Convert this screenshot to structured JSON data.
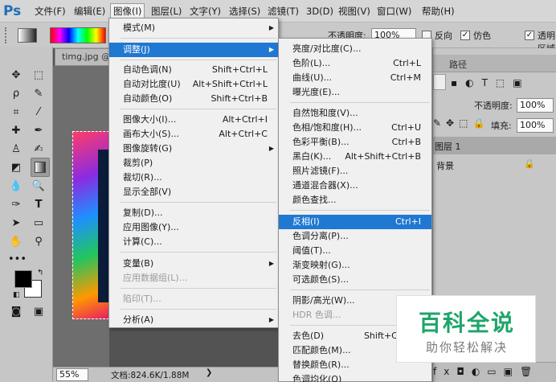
{
  "app": {
    "logo": "Ps"
  },
  "menubar": {
    "items": [
      "文件(F)",
      "编辑(E)",
      "图像(I)",
      "图层(L)",
      "文字(Y)",
      "选择(S)",
      "滤镜(T)",
      "3D(D)",
      "视图(V)",
      "窗口(W)",
      "帮助(H)"
    ]
  },
  "options": {
    "opacity_label": "不透明度:",
    "opacity_value": "100%",
    "reverse_label": "反向",
    "dither_label": "仿色",
    "transparency_label": "透明区域"
  },
  "document": {
    "tab_title": "timg.jpg @",
    "zoom": "55%",
    "doc_info": "文档:824.6K/1.88M"
  },
  "image_menu": {
    "items": [
      {
        "label": "模式(M)",
        "shortcut": "",
        "submenu": true
      },
      {
        "label": "调整(J)",
        "shortcut": "",
        "submenu": true,
        "highlight": true
      },
      {
        "label": "自动色调(N)",
        "shortcut": "Shift+Ctrl+L"
      },
      {
        "label": "自动对比度(U)",
        "shortcut": "Alt+Shift+Ctrl+L"
      },
      {
        "label": "自动颜色(O)",
        "shortcut": "Shift+Ctrl+B"
      },
      {
        "label": "图像大小(I)...",
        "shortcut": "Alt+Ctrl+I"
      },
      {
        "label": "画布大小(S)...",
        "shortcut": "Alt+Ctrl+C"
      },
      {
        "label": "图像旋转(G)",
        "shortcut": "",
        "submenu": true
      },
      {
        "label": "裁剪(P)",
        "shortcut": ""
      },
      {
        "label": "裁切(R)...",
        "shortcut": ""
      },
      {
        "label": "显示全部(V)",
        "shortcut": ""
      },
      {
        "label": "复制(D)...",
        "shortcut": ""
      },
      {
        "label": "应用图像(Y)...",
        "shortcut": ""
      },
      {
        "label": "计算(C)...",
        "shortcut": ""
      },
      {
        "label": "变量(B)",
        "shortcut": "",
        "submenu": true
      },
      {
        "label": "应用数据组(L)...",
        "shortcut": "",
        "disabled": true
      },
      {
        "label": "陷印(T)...",
        "shortcut": "",
        "disabled": true
      },
      {
        "label": "分析(A)",
        "shortcut": "",
        "submenu": true
      }
    ]
  },
  "adjust_menu": {
    "items": [
      {
        "label": "亮度/对比度(C)...",
        "shortcut": ""
      },
      {
        "label": "色阶(L)...",
        "shortcut": "Ctrl+L"
      },
      {
        "label": "曲线(U)...",
        "shortcut": "Ctrl+M"
      },
      {
        "label": "曝光度(E)...",
        "shortcut": ""
      },
      {
        "label": "自然饱和度(V)...",
        "shortcut": ""
      },
      {
        "label": "色相/饱和度(H)...",
        "shortcut": "Ctrl+U"
      },
      {
        "label": "色彩平衡(B)...",
        "shortcut": "Ctrl+B"
      },
      {
        "label": "黑白(K)...",
        "shortcut": "Alt+Shift+Ctrl+B"
      },
      {
        "label": "照片滤镜(F)...",
        "shortcut": ""
      },
      {
        "label": "通道混合器(X)...",
        "shortcut": ""
      },
      {
        "label": "颜色查找...",
        "shortcut": ""
      },
      {
        "label": "反相(I)",
        "shortcut": "Ctrl+I",
        "highlight": true
      },
      {
        "label": "色调分离(P)...",
        "shortcut": ""
      },
      {
        "label": "阈值(T)...",
        "shortcut": ""
      },
      {
        "label": "渐变映射(G)...",
        "shortcut": ""
      },
      {
        "label": "可选颜色(S)...",
        "shortcut": ""
      },
      {
        "label": "阴影/高光(W)...",
        "shortcut": ""
      },
      {
        "label": "HDR 色调...",
        "shortcut": "",
        "disabled": true
      },
      {
        "label": "去色(D)",
        "shortcut": "Shift+Ctrl+U"
      },
      {
        "label": "匹配颜色(M)...",
        "shortcut": ""
      },
      {
        "label": "替换颜色(R)...",
        "shortcut": ""
      },
      {
        "label": "色调均化(Q)",
        "shortcut": ""
      }
    ]
  },
  "panels": {
    "tab_path": "路径",
    "opacity_label": "不透明度:",
    "opacity_value": "100%",
    "fill_label": "填充:",
    "fill_value": "100%",
    "layers": [
      "图层 1",
      "背景"
    ]
  },
  "watermark": {
    "title": "百科全说",
    "subtitle": "助你轻松解决"
  },
  "colors": {
    "highlight": "#1f78d1",
    "watermark_green": "#1ea56a"
  }
}
